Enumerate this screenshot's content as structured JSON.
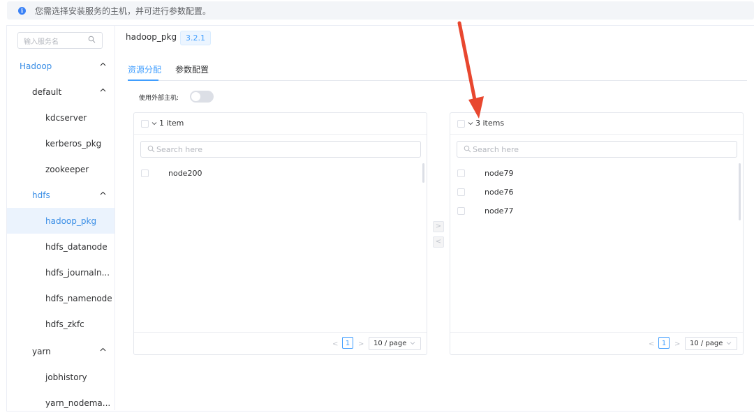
{
  "notice": {
    "text": "您需选择安装服务的主机，并可进行参数配置。"
  },
  "sidebar": {
    "search_placeholder": "输入服务名",
    "items": [
      {
        "label": "Hadoop"
      },
      {
        "label": "default"
      },
      {
        "label": "kdcserver"
      },
      {
        "label": "kerberos_pkg"
      },
      {
        "label": "zookeeper"
      },
      {
        "label": "hdfs"
      },
      {
        "label": "hadoop_pkg"
      },
      {
        "label": "hdfs_datanode"
      },
      {
        "label": "hdfs_journaln..."
      },
      {
        "label": "hdfs_namenode"
      },
      {
        "label": "hdfs_zkfc"
      },
      {
        "label": "yarn"
      },
      {
        "label": "jobhistory"
      },
      {
        "label": "yarn_nodema..."
      }
    ]
  },
  "header": {
    "title": "hadoop_pkg",
    "version": "3.2.1"
  },
  "tabs": [
    {
      "label": "资源分配"
    },
    {
      "label": "参数配置"
    }
  ],
  "external_host": {
    "label": "使用外部主机:",
    "enabled": false
  },
  "transfer": {
    "left": {
      "count": "1 item",
      "search_placeholder": "Search here",
      "items": [
        {
          "label": "node200"
        }
      ],
      "page": "1",
      "page_size": "10 / page"
    },
    "right": {
      "count": "3 items",
      "search_placeholder": "Search here",
      "items": [
        {
          "label": "node79"
        },
        {
          "label": "node76"
        },
        {
          "label": "node77"
        }
      ],
      "page": "1",
      "page_size": "10 / page"
    }
  },
  "colors": {
    "accent": "#409eff",
    "annotation_arrow": "#e8472f"
  }
}
